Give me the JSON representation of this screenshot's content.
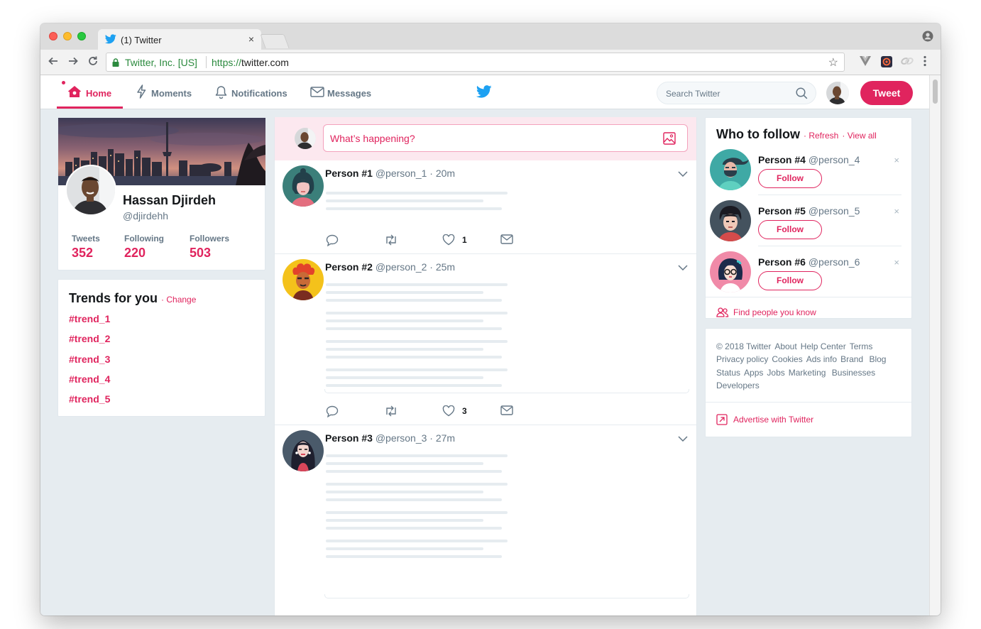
{
  "browser": {
    "tab_title": "(1) Twitter",
    "tab_close": "×",
    "org_label": "Twitter, Inc. [US]",
    "url_scheme": "https://",
    "url_host": "twitter.com"
  },
  "nav": {
    "items": [
      {
        "label": "Home",
        "icon": "home-icon",
        "active": true
      },
      {
        "label": "Moments",
        "icon": "lightning-icon"
      },
      {
        "label": "Notifications",
        "icon": "bell-icon"
      },
      {
        "label": "Messages",
        "icon": "envelope-icon"
      }
    ],
    "search_placeholder": "Search Twitter",
    "tweet_button": "Tweet"
  },
  "profile": {
    "name": "Hassan Djirdeh",
    "handle": "@djirdehh",
    "stats": [
      {
        "label": "Tweets",
        "value": "352"
      },
      {
        "label": "Following",
        "value": "220"
      },
      {
        "label": "Followers",
        "value": "503"
      }
    ]
  },
  "trends": {
    "title": "Trends for you",
    "change_label": "· Change",
    "items": [
      "#trend_1",
      "#trend_2",
      "#trend_3",
      "#trend_4",
      "#trend_5"
    ]
  },
  "compose": {
    "placeholder": "What’s happening?"
  },
  "tweets": [
    {
      "name": "Person #1",
      "meta": "@person_1 · 20m",
      "likes": "1"
    },
    {
      "name": "Person #2",
      "meta": "@person_2 · 25m",
      "likes": "3"
    },
    {
      "name": "Person #3",
      "meta": "@person_3 · 27m"
    }
  ],
  "who_to_follow": {
    "title": "Who to follow",
    "refresh_label": "· Refresh",
    "view_all_label": "· View all",
    "follow_label": "Follow",
    "dismiss_label": "×",
    "people": [
      {
        "name": "Person #4",
        "handle": "@person_4"
      },
      {
        "name": "Person #5",
        "handle": "@person_5"
      },
      {
        "name": "Person #6",
        "handle": "@person_6"
      }
    ],
    "find_people": "Find people you know"
  },
  "footer": {
    "links": [
      "© 2018 Twitter",
      "About",
      "Help Center",
      "Terms",
      "Privacy policy",
      "Cookies",
      "Ads info",
      "Brand",
      "Blog",
      "Status",
      "Apps",
      "Jobs",
      "Marketing",
      "Businesses",
      "Developers"
    ],
    "advertise": "Advertise with Twitter"
  },
  "colors": {
    "accent": "#e0245e",
    "twitter_blue": "#1da1f2",
    "background": "#e6ecf0",
    "secondary_text": "#657786"
  }
}
